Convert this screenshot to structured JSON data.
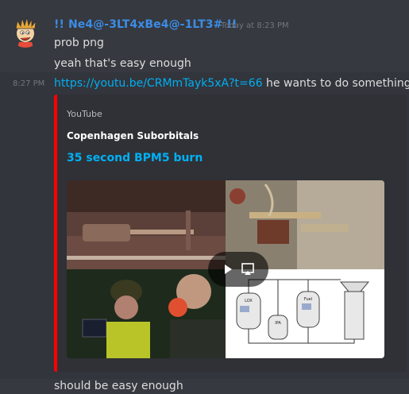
{
  "message_group": {
    "username": "!! Ne4@-3LT4xBe4@-1LT3# !!",
    "header_timestamp": "Today at 8:23 PM",
    "messages": [
      {
        "text": "prob png"
      },
      {
        "text": "yeah that's easy enough"
      }
    ]
  },
  "link_message": {
    "side_timestamp": "8:27 PM",
    "url": "https://youtu.be/CRMmTayk5xA?t=66",
    "text_after": " he wants to do something"
  },
  "embed": {
    "provider": "YouTube",
    "author": "Copenhagen Suborbitals",
    "title": "35 second BPM5 burn",
    "accent_color": "#ff0000",
    "thumbnail_labels": {
      "lox": "LOX",
      "fuel": "Fuel",
      "ipa": "IPA"
    }
  },
  "last_message": {
    "text": "should be easy enough"
  },
  "colors": {
    "background": "#36393f",
    "username": "#3c8ce6",
    "link": "#00aff4"
  }
}
